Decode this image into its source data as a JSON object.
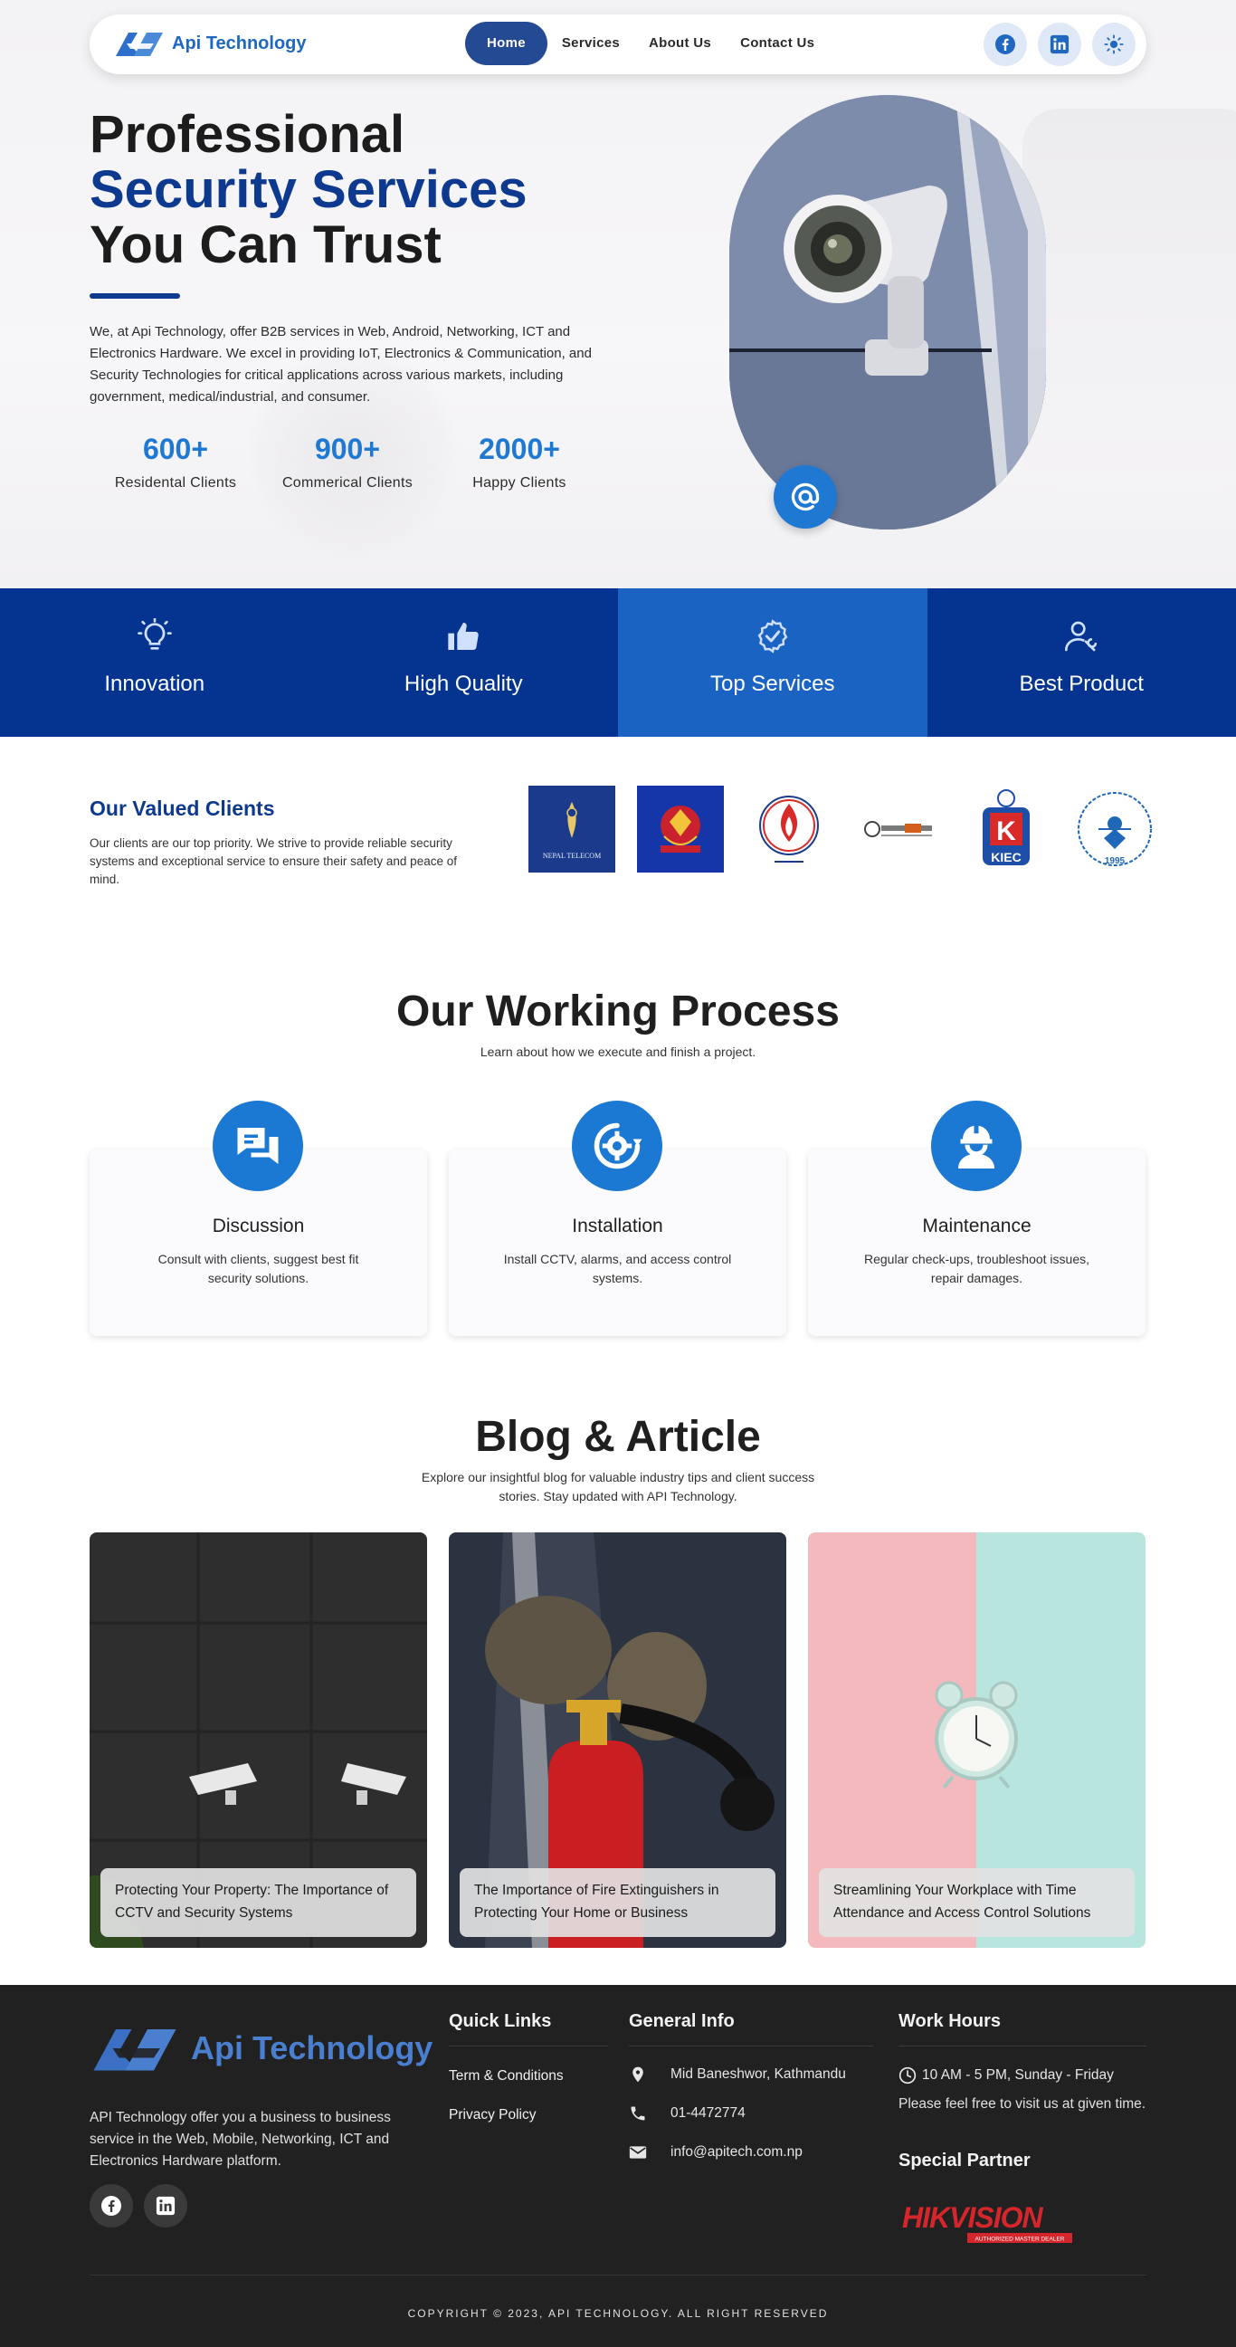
{
  "nav": {
    "brand": "Api Technology",
    "links": [
      "Home",
      "Services",
      "About Us",
      "Contact Us"
    ],
    "icons": [
      "facebook-icon",
      "linkedin-icon",
      "sun-icon"
    ]
  },
  "hero": {
    "title_line1": "Professional",
    "title_line2": "Security Services",
    "title_line3": "You Can Trust",
    "description": "We, at Api Technology, offer B2B services in Web, Android, Networking, ICT and Electronics Hardware. We excel in providing IoT, Electronics & Communication, and Security Technologies for critical applications across various markets, including government, medical/industrial, and consumer.",
    "stats": [
      {
        "value": "600+",
        "label": "Residental Clients"
      },
      {
        "value": "900+",
        "label": "Commerical Clients"
      },
      {
        "value": "2000+",
        "label": "Happy Clients"
      }
    ]
  },
  "features": [
    {
      "label": "Innovation",
      "icon": "lightbulb-icon"
    },
    {
      "label": "High Quality",
      "icon": "thumbs-up-icon"
    },
    {
      "label": "Top Services",
      "icon": "verified-badge-icon"
    },
    {
      "label": "Best Product",
      "icon": "user-wrench-icon"
    }
  ],
  "clients": {
    "title": "Our Valued Clients",
    "description": "Our clients are our top priority. We strive to provide reliable security systems and exceptional service to ensure their safety and peace of mind.",
    "logos": [
      "NEPAL TELECOM",
      "Nepal Police",
      "Fire Service",
      "Nepali Tech",
      "KIEC",
      "Forum for Women, Law and Development"
    ],
    "logo_nepal_telecom": "NEPAL TELECOM",
    "logo_kiec": "KIEC",
    "logo_fwld_year": "1995"
  },
  "process": {
    "title": "Our Working Process",
    "subtitle": "Learn about how we execute and finish a project.",
    "steps": [
      {
        "title": "Discussion",
        "desc": "Consult with clients, suggest best fit security solutions.",
        "icon": "chat-icon"
      },
      {
        "title": "Installation",
        "desc": "Install CCTV, alarms, and access control systems.",
        "icon": "gear-refresh-icon"
      },
      {
        "title": "Maintenance",
        "desc": "Regular check-ups, troubleshoot issues, repair damages.",
        "icon": "worker-icon"
      }
    ]
  },
  "blog": {
    "title": "Blog & Article",
    "subtitle": "Explore our insightful blog for valuable industry tips and client success stories. Stay updated with API Technology.",
    "posts": [
      {
        "title": "Protecting Your Property: The Importance of CCTV and Security Systems"
      },
      {
        "title": "The Importance of Fire Extinguishers in Protecting Your Home or Business"
      },
      {
        "title": "Streamlining Your Workplace with Time Attendance and Access Control Solutions"
      }
    ]
  },
  "footer": {
    "brand": "Api Technology",
    "description": "API Technology offer you a business to business service in the Web, Mobile, Networking, ICT and Electronics Hardware platform.",
    "quick_links_title": "Quick Links",
    "quick_links": [
      "Term & Conditions",
      "Privacy Policy"
    ],
    "general_info_title": "General Info",
    "address": "Mid Baneshwor, Kathmandu",
    "phone": "01-4472774",
    "email": "info@apitech.com.np",
    "work_hours_title": "Work Hours",
    "hours": "10 AM - 5 PM, Sunday - Friday",
    "visit_note": "Please feel free to visit us at given time.",
    "partner_title": "Special Partner",
    "partner_name": "HIKVISION",
    "partner_tagline": "AUTHORIZED MASTER DEALER",
    "copyright": "COPYRIGHT © 2023, API TECHNOLOGY. ALL RIGHT RESERVED"
  },
  "colors": {
    "brand_blue": "#1f67c1",
    "navy": "#0d3a8e",
    "feature_bar": "#043490",
    "feature_active": "#1b63c3",
    "footer_bg": "#212121"
  }
}
